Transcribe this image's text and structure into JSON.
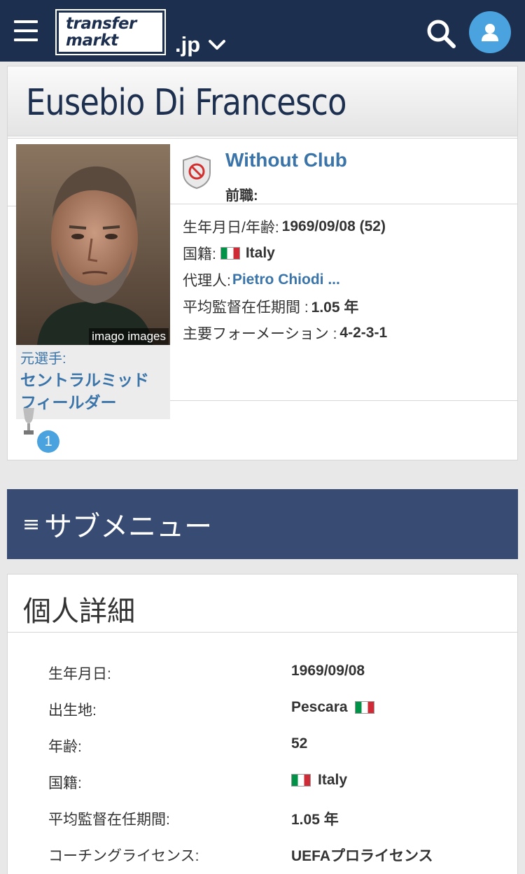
{
  "header": {
    "logo_line1": "transfer",
    "logo_line2": "markt",
    "domain": ".jp",
    "icons": {
      "menu": "hamburger-menu-icon",
      "search": "search-icon",
      "user": "user-icon",
      "domain_toggle": "chevron-down-icon"
    }
  },
  "profile": {
    "first_name": "Eusebio",
    "last_name": "Di Francesco",
    "photo_credit": "imago images",
    "position_label": "元選手:",
    "position_value_line1": "セントラルミッド",
    "position_value_line2": "フィールダー",
    "trophy_count": "1",
    "club": {
      "name": "Without Club",
      "previous_label": "前職:"
    },
    "info": {
      "birth_label": "生年月日/年齢:",
      "birth_value": "1969/09/08 (52)",
      "nationality_label": "国籍:",
      "nationality_value": "Italy",
      "agent_label": "代理人:",
      "agent_value": "Pietro Chiodi ...",
      "tenure_label": "平均監督在任期間 :",
      "tenure_value": "1.05 年",
      "formation_label": "主要フォーメーション :",
      "formation_value": "4-2-3-1"
    }
  },
  "submenu": {
    "label": "サブメニュー"
  },
  "details": {
    "title": "個人詳細",
    "rows": [
      {
        "label": "生年月日:",
        "value": "1969/09/08"
      },
      {
        "label": "出生地:",
        "value": "Pescara"
      },
      {
        "label": "年齢:",
        "value": "52"
      },
      {
        "label": "国籍:",
        "value": "Italy"
      },
      {
        "label": "平均監督在任期間:",
        "value": "1.05 年"
      },
      {
        "label": "コーチングライセンス:",
        "value": "UEFAプロライセンス"
      }
    ]
  },
  "colors": {
    "header_bg": "#1d2f4f",
    "link": "#3a74a8",
    "submenu_bg": "#384b73",
    "accent": "#4aa3df"
  }
}
